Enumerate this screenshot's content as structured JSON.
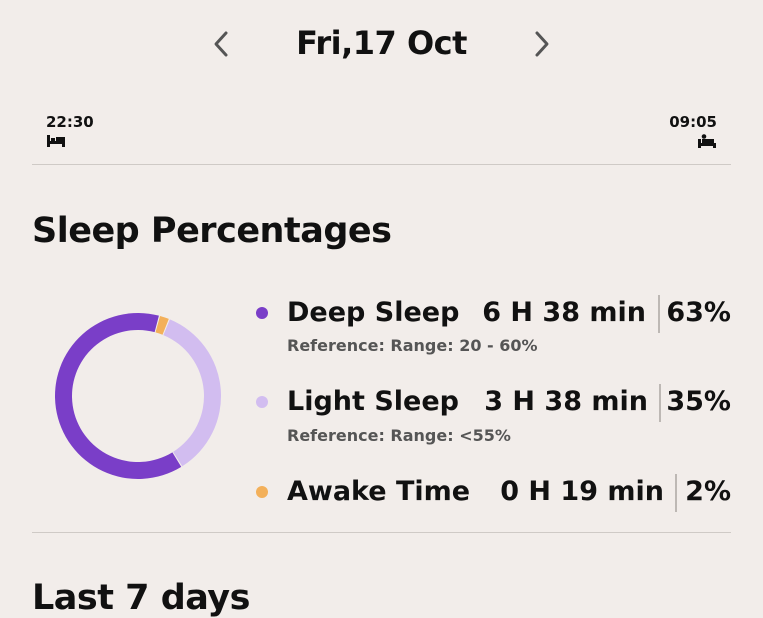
{
  "date_nav": {
    "title": "Fri,17 Oct"
  },
  "sleep_times": {
    "bedtime": "22:30",
    "waketime": "09:05"
  },
  "sleep_percentages": {
    "title": "Sleep Percentages",
    "items": [
      {
        "label": "Deep Sleep",
        "duration": "6 H 38 min",
        "percent": "63%",
        "reference": "Reference: Range: 20 - 60%",
        "color": "#7a3ec8"
      },
      {
        "label": "Light Sleep",
        "duration": "3 H 38 min",
        "percent": "35%",
        "reference": "Reference: Range: <55%",
        "color": "#d2bdf0"
      },
      {
        "label": "Awake Time",
        "duration": "0 H 19 min",
        "percent": "2%",
        "color": "#f3b05a"
      }
    ]
  },
  "last_7_days": {
    "title": "Last 7 days"
  },
  "icons": {
    "prev": "chevron-left-icon",
    "next": "chevron-right-icon",
    "bed": "bed-icon",
    "wake": "wake-up-icon"
  }
}
